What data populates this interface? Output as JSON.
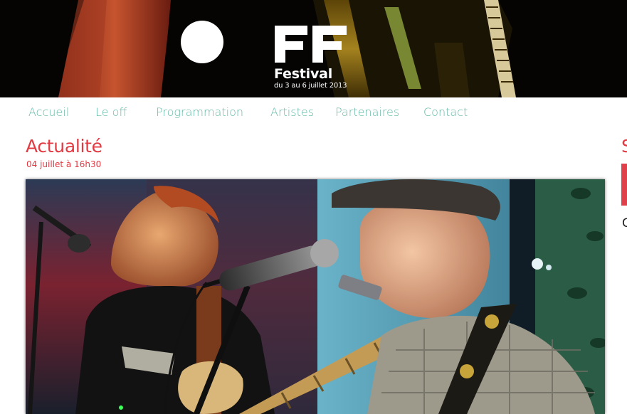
{
  "header": {
    "logo_mark": "FF",
    "brand_name": "Festival",
    "brand_dates": "du 3 au 6 juillet 2013"
  },
  "nav": {
    "items": [
      {
        "label": "Accueil"
      },
      {
        "label": "Le off"
      },
      {
        "label": "Programmation"
      },
      {
        "label": "Artistes"
      },
      {
        "label": "Partenaires"
      },
      {
        "label": "Contact"
      }
    ]
  },
  "main": {
    "section_title": "Actualité",
    "post_date": "04 juillet à 16h30"
  },
  "sidebar": {
    "heading_partial": "S",
    "text_partial": "C"
  },
  "colors": {
    "accent_red": "#e23a43",
    "nav_teal": "#64b9a6",
    "header_bg": "#050403"
  }
}
